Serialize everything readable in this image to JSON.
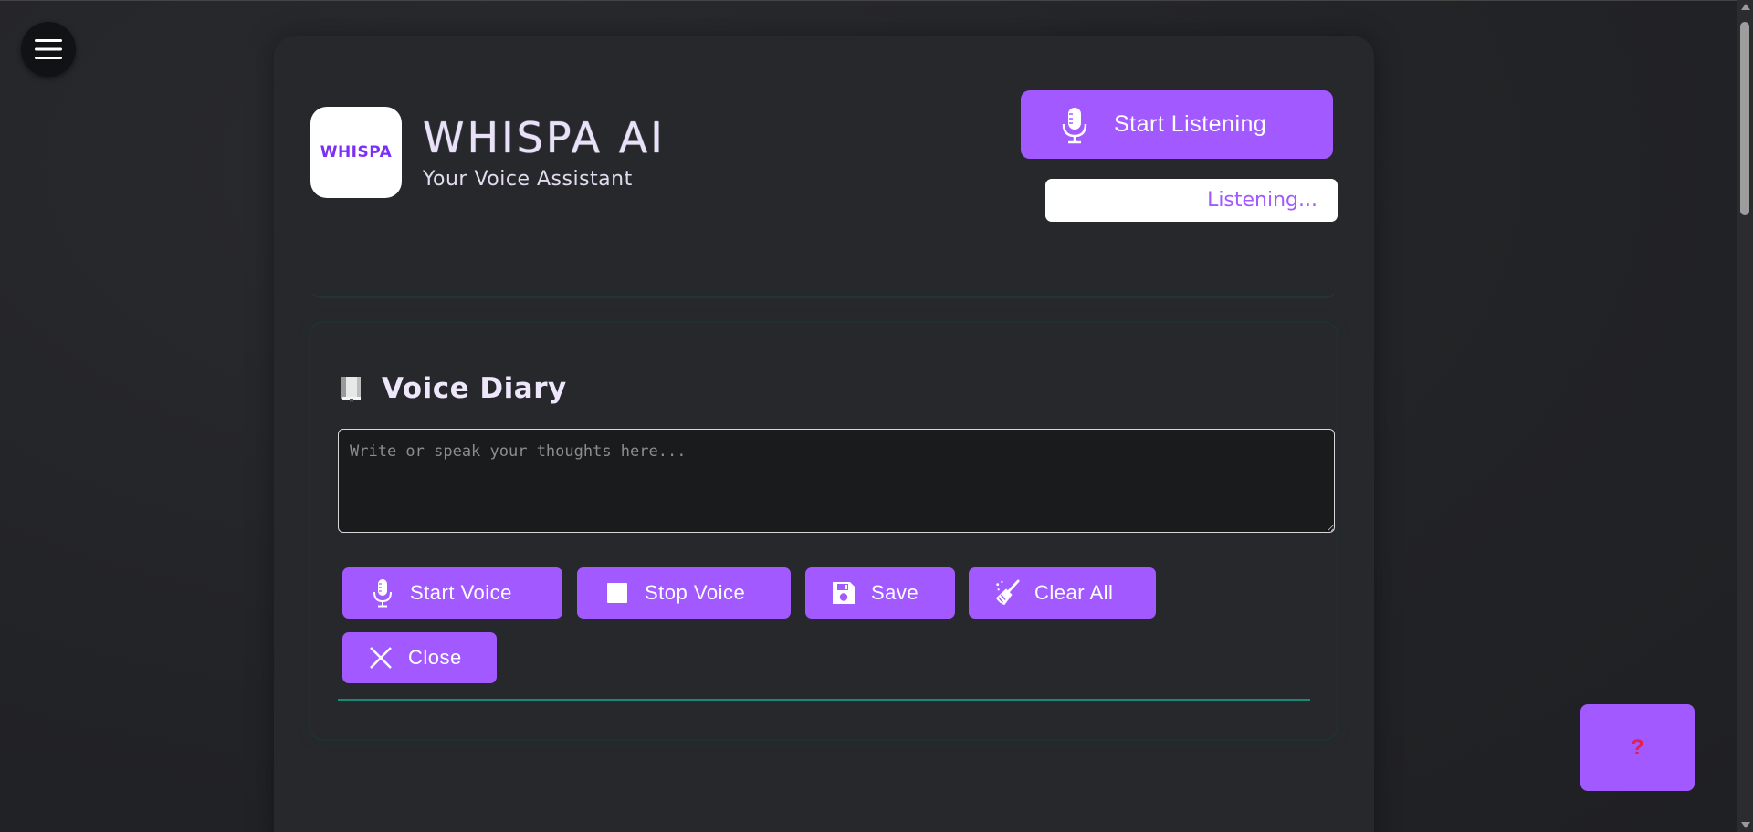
{
  "app": {
    "logo_text": "WHISPA",
    "title": "WHISPA AI",
    "subtitle": "Your Voice Assistant"
  },
  "header": {
    "listen_button_label": "Start Listening",
    "status_text": "Listening..."
  },
  "diary": {
    "title": "Voice Diary",
    "placeholder": "Write or speak your thoughts here...",
    "value": ""
  },
  "actions": {
    "start_voice": "Start Voice",
    "stop_voice": "Stop Voice",
    "save": "Save",
    "clear_all": "Clear All",
    "close": "Close"
  },
  "help": {
    "label": "?"
  },
  "colors": {
    "accent": "#a259ff",
    "background": "#232427",
    "divider": "#168a78",
    "help_glyph": "#e02050"
  }
}
